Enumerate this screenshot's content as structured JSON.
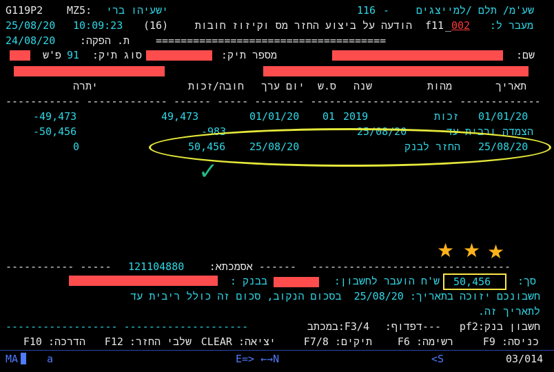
{
  "header": {
    "screen_id": "G119P2",
    "user_code": "MZ5:",
    "user_name": "ישעיהו ברי",
    "dept_title": "שע'מ/ תלם /למייצגים",
    "dash": "-",
    "screen_num": "116",
    "date": "25/08/20",
    "time": "10:09:23",
    "title_num": "(16)",
    "title_text": "הודעה על ביצוע החזר מס וקיזוז חובות",
    "f11": "f11",
    "field_sep": "_",
    "transfer_code": "002",
    "transfer_label": "מעבר ל:",
    "issue_date": "24/08/20",
    "issue_label": "ת. הפקה:",
    "rule": "====================================="
  },
  "file_info": {
    "ps_label": "פ'ש",
    "file_type_value": "91",
    "file_type_label": "סוג תיק:",
    "file_number_label": "מספר תיק:",
    "name_label": "שם:"
  },
  "table": {
    "col_date": "תאריך",
    "col_nature": "מהות",
    "col_year": "שנה",
    "col_ss": "ס.ש",
    "col_value_date": "יום ערך",
    "col_debit_credit": "חובה/זכות",
    "col_balance": "יתרה",
    "separator": "------------ ------------- ------ ----- -------- ----------------------- -------------",
    "rows": [
      {
        "date": "01/01/20",
        "nature": "זכות",
        "year": "2019",
        "ss": "01",
        "value_date": "01/01/20",
        "amount": "49,473",
        "balance": "-49,473"
      },
      {
        "date": "",
        "nature": "הצמדה ורבית עד",
        "year": "25/08/20",
        "ss": "",
        "value_date": "",
        "amount": "-983",
        "balance": "-50,456"
      },
      {
        "date": "25/08/20",
        "nature": "החזר לבנק",
        "year": "",
        "ss": "",
        "value_date": "25/08/20",
        "amount": "50,456",
        "balance": "0"
      }
    ]
  },
  "footer": {
    "reference_line_right": "------ אסמכתא:",
    "reference_value": "121104880",
    "reference_line_left": "----------- -----",
    "reference_line_far_right": "--------------------------------",
    "total_label": "סך:",
    "total_value": "50,456",
    "transferred_label": "ש'ח הועבר לחשבון:",
    "bank_label": "בבנק :",
    "msg_line1": "חשבונכם יזוכה בתאריך: 25/08/20  בסכום הנקוב, סכום זה כולל ריבית עד",
    "msg_line2": "לתאריך זה.",
    "bank_account_label": "חשבון בנק:pf2",
    "print_label": "---דפדוף:",
    "print_key": "F3/4:במכתב",
    "dash_line": "------------------ --------------------"
  },
  "keys": {
    "entry": "כניסה: F9",
    "list": "רשימה: F6",
    "files": "תיקים: F7/8",
    "exit": "יציאה: CLEAR",
    "refund_stages": "שלבי החזר: F12",
    "guide": "הדרכה: F10"
  },
  "status": {
    "left": "MA",
    "mode": "a",
    "nav": "E=> ←→N",
    "page_mark": "<S",
    "position": "03/014"
  },
  "colors": {
    "background": "#000000",
    "text_white": "#e8e8e8",
    "text_cyan": "#2fd7e6",
    "highlight_red": "#ff3a3a",
    "redaction": "#ff4d4d",
    "annotation_yellow": "#ffe84a",
    "star": "#ffb31a",
    "check": "#24b98a"
  },
  "icons": {
    "stars": [
      "star-icon",
      "star-icon",
      "star-icon"
    ],
    "check": "check-icon"
  }
}
